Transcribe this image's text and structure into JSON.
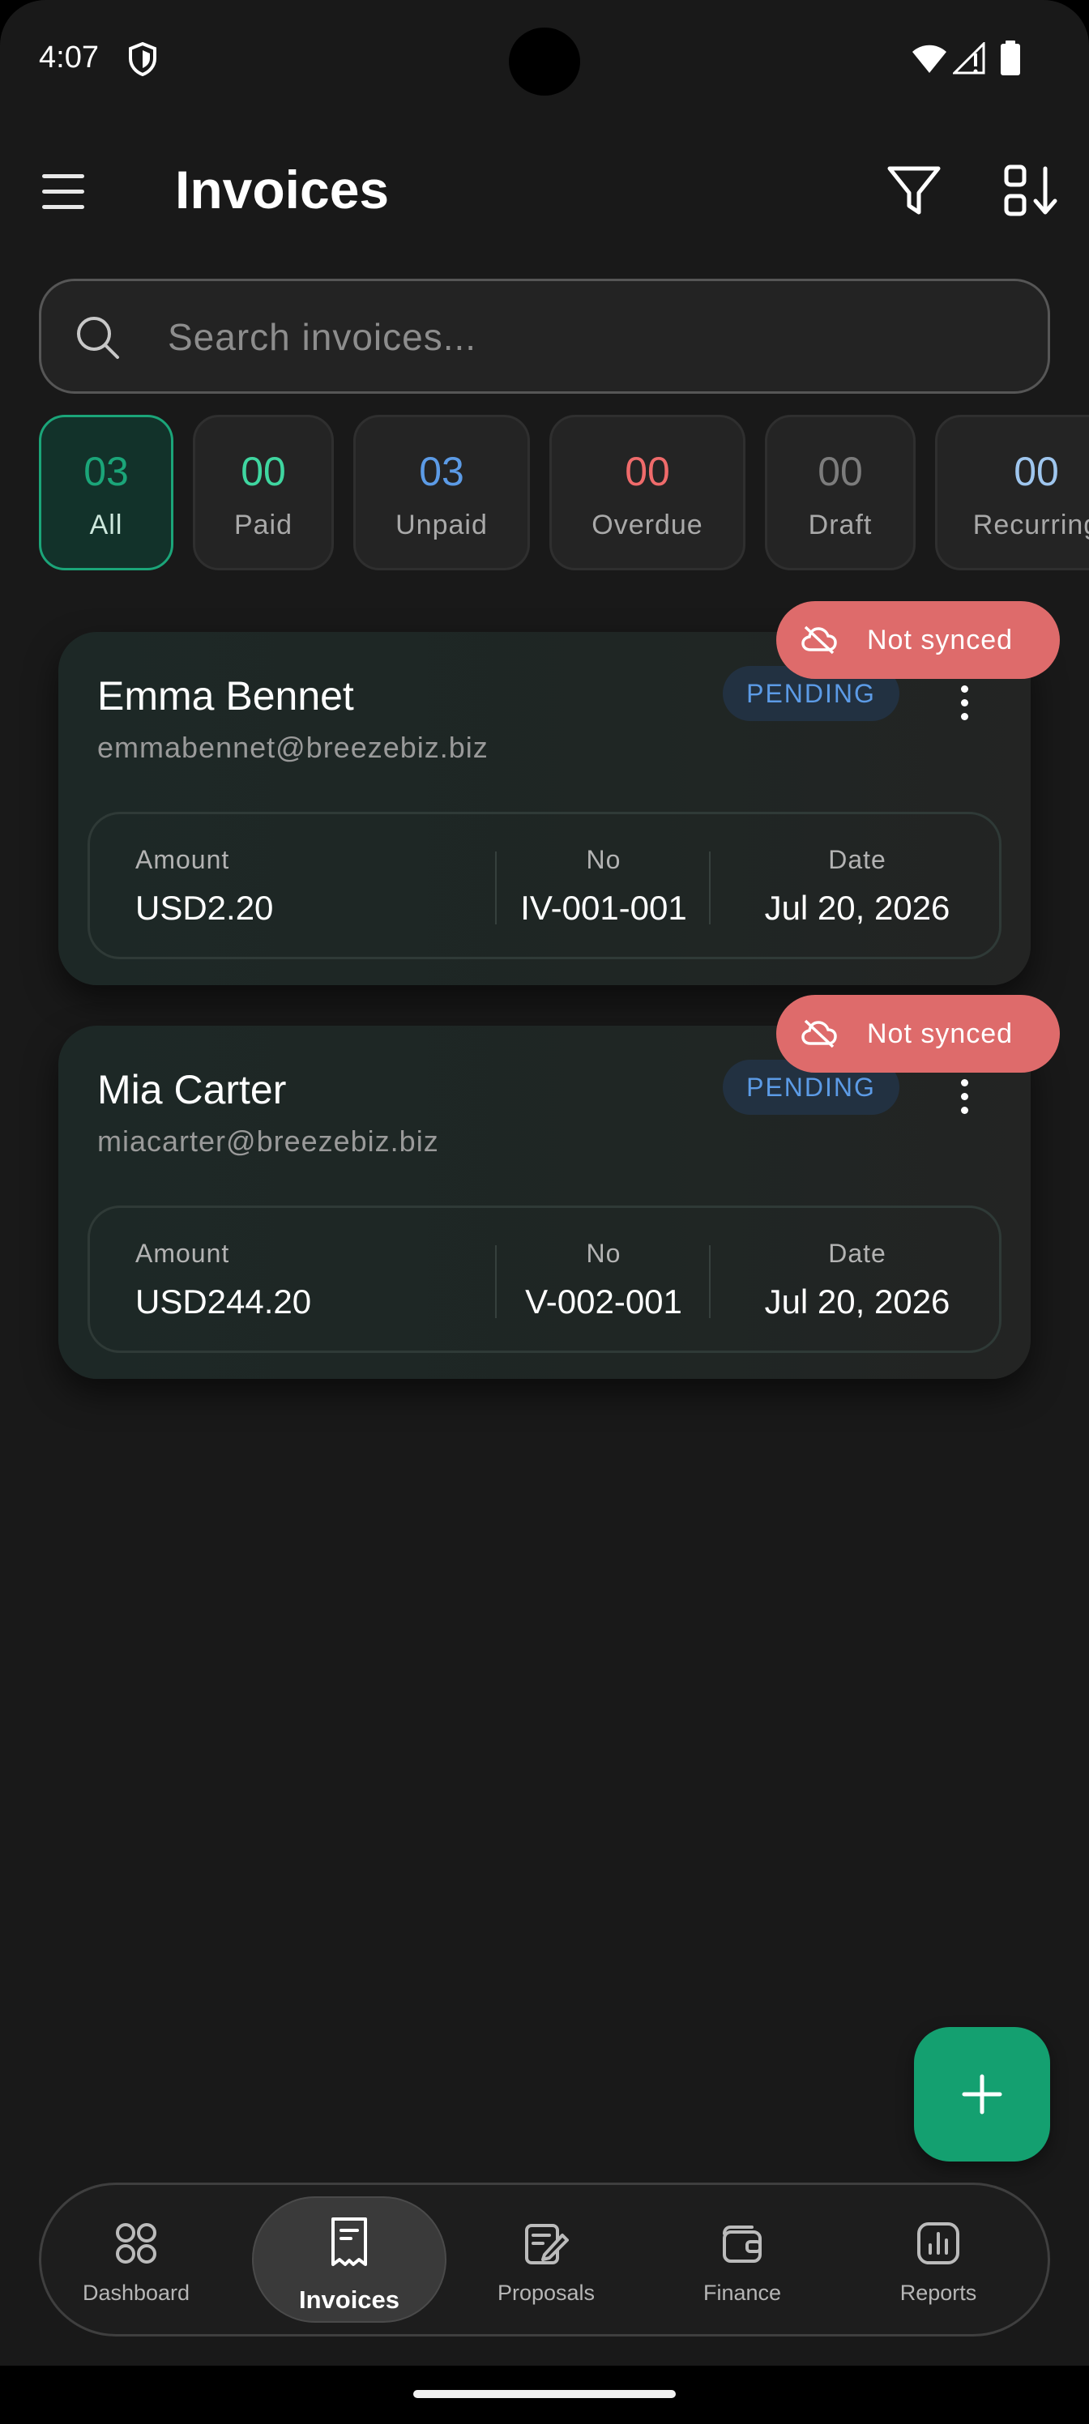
{
  "status_bar": {
    "time": "4:07"
  },
  "header": {
    "title": "Invoices"
  },
  "search": {
    "placeholder": "Search invoices..."
  },
  "filters": [
    {
      "count": "03",
      "label": "All",
      "color": "#1ba579",
      "active": true
    },
    {
      "count": "00",
      "label": "Paid",
      "color": "#3fd6a0"
    },
    {
      "count": "03",
      "label": "Unpaid",
      "color": "#5c9be6"
    },
    {
      "count": "00",
      "label": "Overdue",
      "color": "#ef6b6b"
    },
    {
      "count": "00",
      "label": "Draft",
      "color": "#7c7c7c"
    },
    {
      "count": "00",
      "label": "Recurring",
      "color": "#9fc6ee"
    }
  ],
  "invoices": [
    {
      "sync_label": "Not synced",
      "client_name": "Emma Bennet",
      "client_email": "emmabennet@breezebiz.biz",
      "status": "PENDING",
      "amount_label": "Amount",
      "amount": "USD2.20",
      "no_label": "No",
      "number": "IV-001-001",
      "date_label": "Date",
      "date": "Jul 20, 2026"
    },
    {
      "sync_label": "Not synced",
      "client_name": "Mia Carter",
      "client_email": "miacarter@breezebiz.biz",
      "status": "PENDING",
      "amount_label": "Amount",
      "amount": "USD244.20",
      "no_label": "No",
      "number": "V-002-001",
      "date_label": "Date",
      "date": "Jul 20, 2026"
    }
  ],
  "nav": [
    {
      "label": "Dashboard",
      "icon": "grid-icon"
    },
    {
      "label": "Invoices",
      "icon": "receipt-icon",
      "active": true
    },
    {
      "label": "Proposals",
      "icon": "proposal-icon"
    },
    {
      "label": "Finance",
      "icon": "wallet-icon"
    },
    {
      "label": "Reports",
      "icon": "chart-icon"
    }
  ],
  "colors": {
    "accent": "#14a070",
    "pending": "#5c9be6",
    "not_synced": "#de6b6b"
  }
}
